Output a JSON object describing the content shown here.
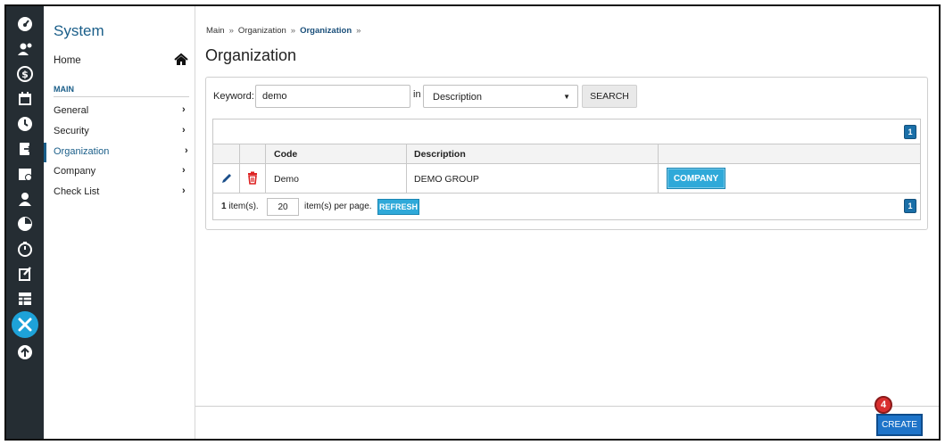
{
  "colors": {
    "rail": "#252d33",
    "accent": "#1a5e89",
    "button": "#2fa9d9",
    "create": "#1e74c9",
    "badge": "#d92f2f"
  },
  "rail": {
    "icons": [
      "dashboard-icon",
      "users-icon",
      "dollar-icon",
      "calendar-icon",
      "clock-icon",
      "document-export-icon",
      "calendar-check-icon",
      "person-icon",
      "pie-chart-icon",
      "timer-icon",
      "edit-document-icon",
      "table-icon",
      "tools-icon",
      "upload-icon"
    ],
    "active": "tools-icon"
  },
  "sidebar": {
    "title": "System",
    "home_label": "Home",
    "section_label": "MAIN",
    "items": [
      {
        "label": "General"
      },
      {
        "label": "Security"
      },
      {
        "label": "Organization",
        "active": true
      },
      {
        "label": "Company"
      },
      {
        "label": "Check List"
      }
    ]
  },
  "breadcrumb": {
    "items": [
      "Main",
      "Organization",
      "Organization"
    ],
    "separator": "»"
  },
  "page_title": "Organization",
  "search": {
    "keyword_label": "Keyword:",
    "keyword_value": "demo",
    "in_label": "in",
    "field_selected": "Description",
    "button_label": "SEARCH"
  },
  "grid": {
    "page_number": "1",
    "columns": [
      "Code",
      "Description"
    ],
    "rows": [
      {
        "code": "Demo",
        "description": "DEMO GROUP",
        "action_label": "COMPANY"
      }
    ],
    "footer": {
      "count_number": "1",
      "count_suffix": " item(s).",
      "per_page": "20",
      "per_page_label": "item(s) per page.",
      "refresh_label": "REFRESH"
    }
  },
  "footer": {
    "create_label": "CREATE",
    "step_number": "4"
  }
}
